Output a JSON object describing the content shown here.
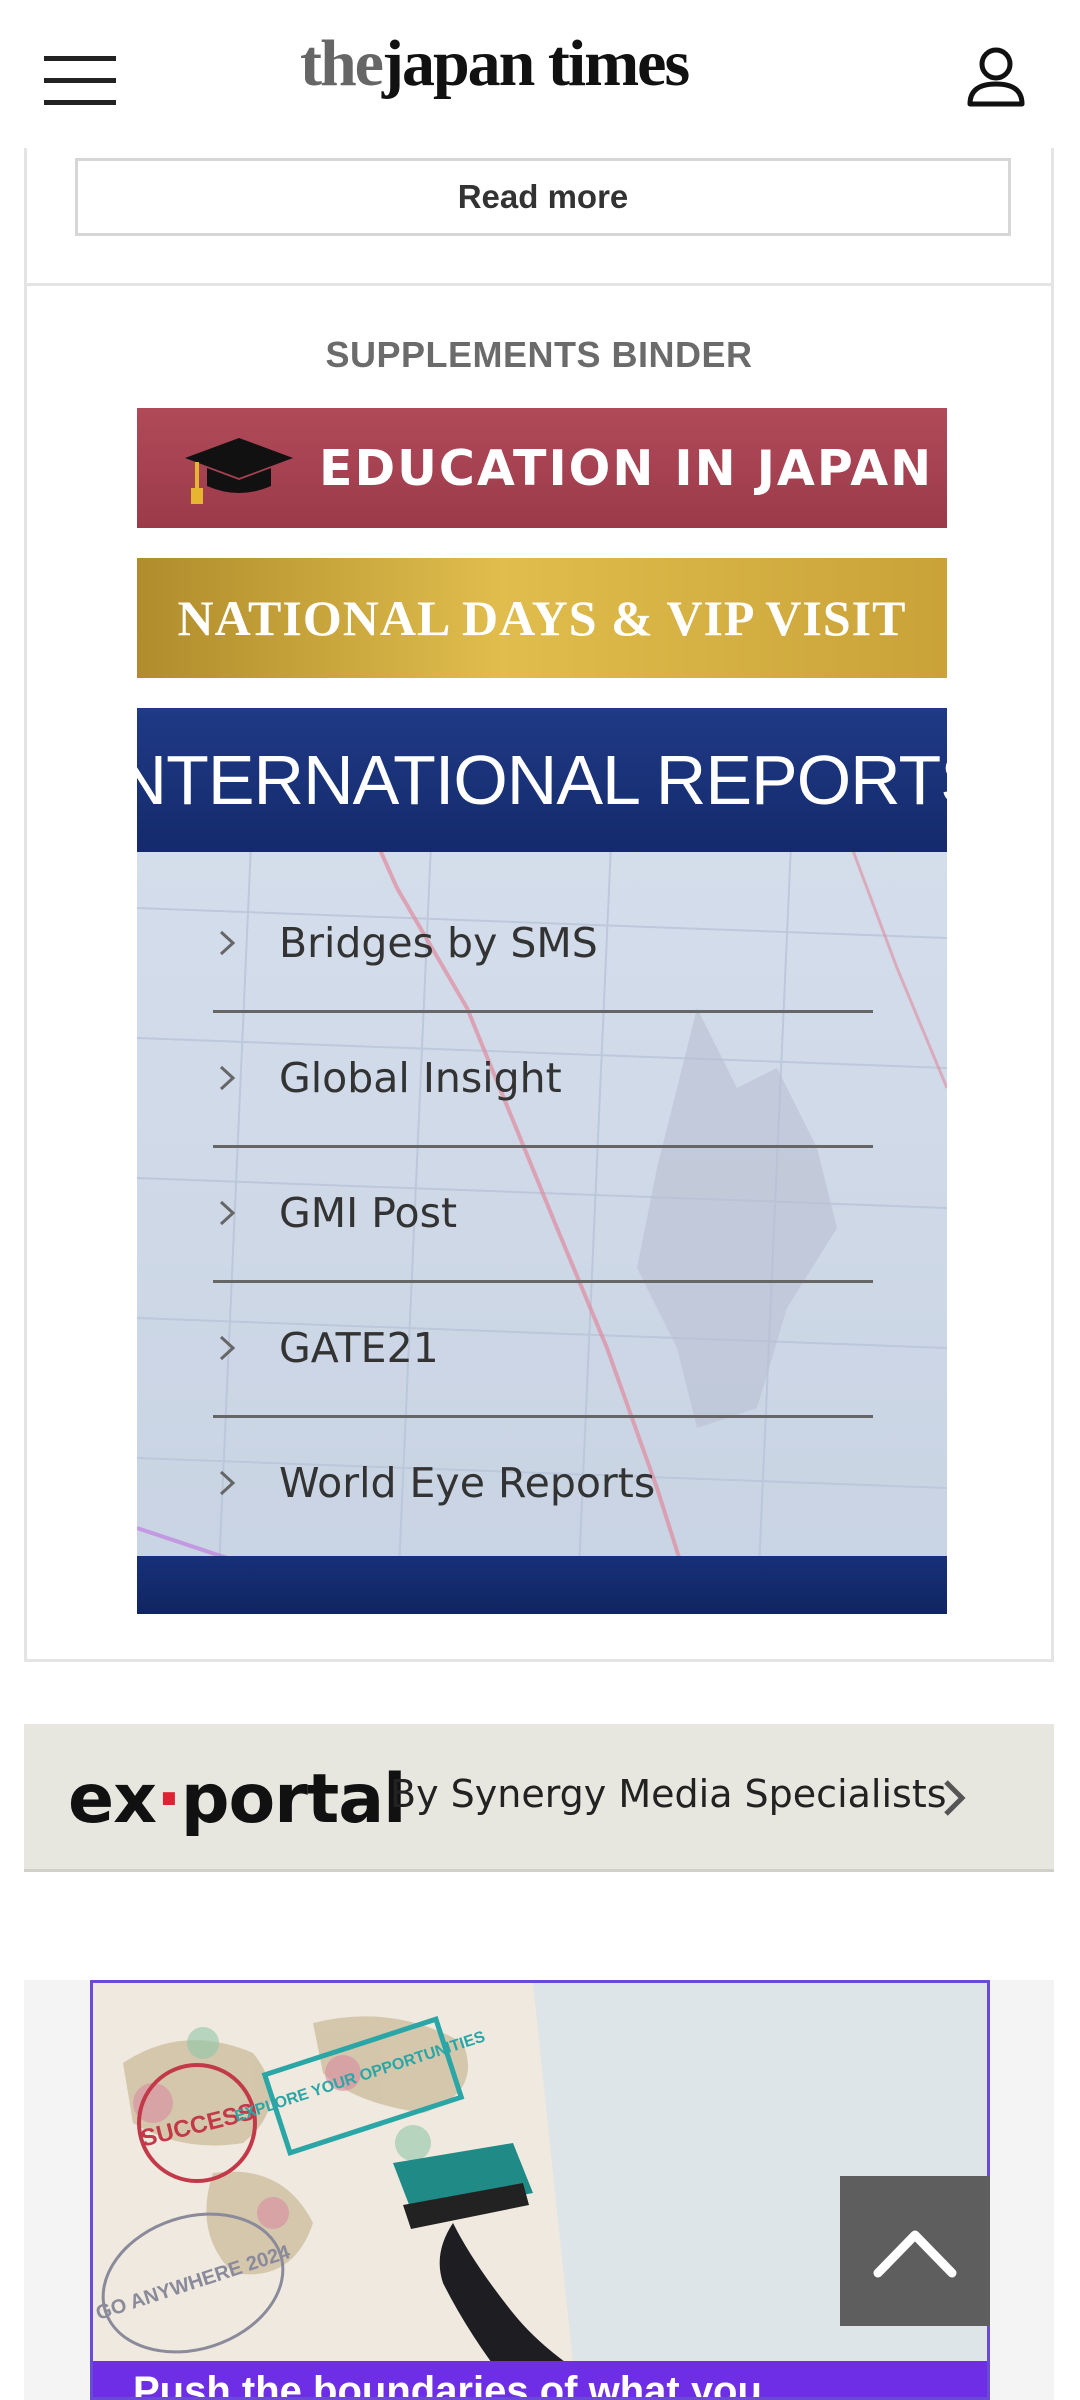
{
  "header": {
    "logo_the": "the",
    "logo_rest": "japan times"
  },
  "article": {
    "read_more_label": "Read more"
  },
  "supplements": {
    "title": "SUPPLEMENTS BINDER",
    "education_banner": "EDUCATION IN JAPAN",
    "national_days_banner": "NATIONAL DAYS & VIP VISIT",
    "international_reports": {
      "heading": "INTERNATIONAL REPORTS",
      "items": [
        {
          "label": "Bridges by SMS"
        },
        {
          "label": "Global Insight"
        },
        {
          "label": "GMI Post"
        },
        {
          "label": "GATE21"
        },
        {
          "label": "World Eye Reports"
        }
      ]
    }
  },
  "exportal": {
    "logo_a": "ex",
    "logo_dot": "·",
    "logo_b": "portal",
    "tagline": "By Synergy Media Specialists"
  },
  "ad": {
    "stamp_success": "SUCCESS",
    "stamp_explore": "EXPLORE YOUR OPPORTUNITIES",
    "stamp_go": "GO ANYWHERE 2024",
    "headline": "Push the boundaries of what you"
  },
  "colors": {
    "education_bg": "#a8414f",
    "national_gold": "#d4af3f",
    "intl_navy": "#1a3278",
    "ad_purple": "#6d2ee6",
    "to_top_bg": "#5e5e5e"
  }
}
